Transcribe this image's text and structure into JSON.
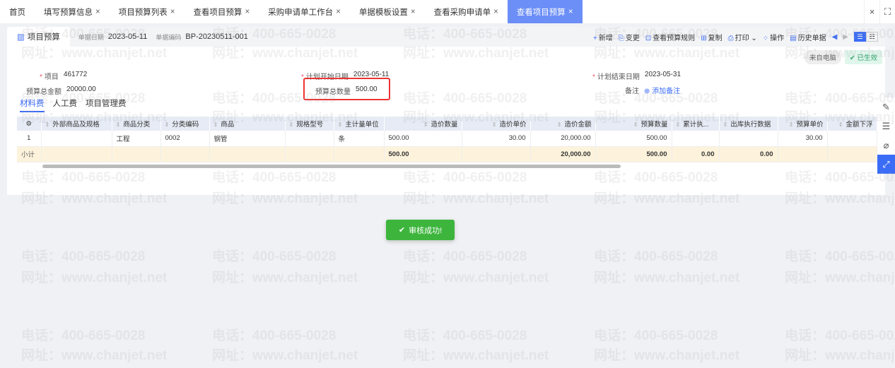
{
  "tabs": [
    {
      "label": "首页",
      "closable": false
    },
    {
      "label": "填写预算信息",
      "closable": true
    },
    {
      "label": "项目预算列表",
      "closable": true
    },
    {
      "label": "查看项目预算",
      "closable": true
    },
    {
      "label": "采购申请单工作台",
      "closable": true
    },
    {
      "label": "单据模板设置",
      "closable": true
    },
    {
      "label": "查看采购申请单",
      "closable": true
    },
    {
      "label": "查看项目预算",
      "closable": true,
      "active": true
    }
  ],
  "window": {
    "close": "×",
    "fullscreen": "⛶"
  },
  "header": {
    "doc_tab": "项目预算",
    "date_label": "单据日期",
    "date": "2023-05-11",
    "code_label": "单据编码",
    "code": "BP-20230511-001"
  },
  "toolbar": {
    "new": "新增",
    "change": "变更",
    "rules": "查看预算规则",
    "copy": "复制",
    "print": "打印",
    "ops": "操作",
    "history": "历史单据"
  },
  "badges": {
    "source": "来自电脑",
    "status": "已生效"
  },
  "form": {
    "project_label": "项目",
    "project": "461772",
    "total_amount_label": "预算总金额",
    "total_amount": "20000.00",
    "start_label": "计划开始日期",
    "start": "2023-05-11",
    "total_qty_label": "预算总数量",
    "total_qty": "500.00",
    "end_label": "计划结束日期",
    "end": "2023-05-31",
    "remark_label": "备注",
    "add_remark": "添加备注"
  },
  "subtabs": [
    "材料费",
    "人工费",
    "项目管理费"
  ],
  "table": {
    "columns": [
      "外部商品及规格",
      "商品分类",
      "分类编码",
      "商品",
      "规格型号",
      "主计量单位",
      "造价数量",
      "造价单价",
      "造价金额",
      "预算数量",
      "累计执...",
      "出库执行数据",
      "预算单价",
      "金额下浮"
    ],
    "rows": [
      [
        "1",
        "",
        "工程",
        "0002",
        "钢管",
        "",
        "条",
        "500.00",
        "30.00",
        "20,000.00",
        "500.00",
        "",
        "",
        "30.00",
        ""
      ]
    ],
    "subtotal": [
      "小计",
      "",
      "",
      "",
      "",
      "",
      "",
      "500.00",
      "",
      "20,000.00",
      "500.00",
      "0.00",
      "0.00",
      "",
      ""
    ]
  },
  "toast": "审核成功!",
  "colors": {
    "accent": "#3b6cf6",
    "tab_active": "#6b8ef7",
    "success": "#3db53d",
    "highlight": "#e33333"
  },
  "watermark": {
    "phone": "电话：400-665-0028",
    "site": "网址：www.chanjet.net"
  }
}
